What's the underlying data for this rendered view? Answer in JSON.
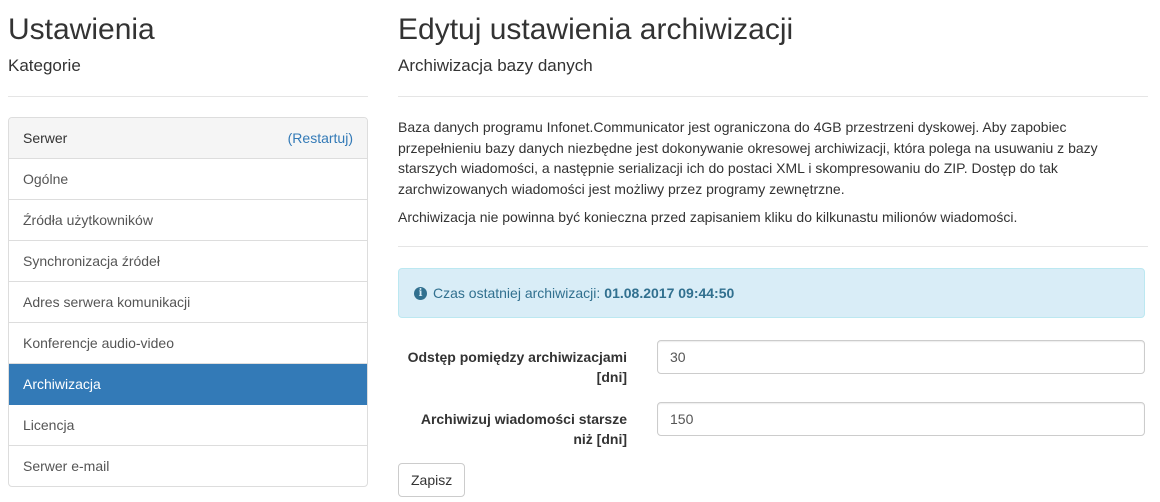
{
  "sidebar": {
    "title": "Ustawienia",
    "subtitle": "Kategorie",
    "header_label": "Serwer",
    "restart_label": "(Restartuj)",
    "items": [
      {
        "label": "Ogólne"
      },
      {
        "label": "Źródła użytkowników"
      },
      {
        "label": "Synchronizacja źródeł"
      },
      {
        "label": "Adres serwera komunikacji"
      },
      {
        "label": "Konferencje audio-video"
      },
      {
        "label": "Archiwizacja"
      },
      {
        "label": "Licencja"
      },
      {
        "label": "Serwer e-mail"
      }
    ],
    "active_item": "Archiwizacja"
  },
  "main": {
    "title": "Edytuj ustawienia archiwizacji",
    "subtitle": "Archiwizacja bazy danych",
    "description": "Baza danych programu Infonet.Communicator jest ograniczona do 4GB przestrzeni dyskowej. Aby zapobiec przepełnieniu bazy danych niezbędne jest dokonywanie okresowej archiwizacji, która polega na usuwaniu z bazy starszych wiadomości, a następnie serializacji ich do postaci XML i skompresowaniu do ZIP. Dostęp do tak zarchwizowanych wiadomości jest możliwy przez programy zewnętrzne.",
    "note": "Archiwizacja nie powinna być konieczna przed zapisaniem kliku do kilkunastu milionów wiadomości.",
    "alert": {
      "label": "Czas ostatniej archiwizacji:",
      "value": "01.08.2017 09:44:50"
    },
    "form": {
      "interval_label": "Odstęp pomiędzy archiwizacjami [dni]",
      "interval_value": "30",
      "older_than_label": "Archiwizuj wiadomości starsze niż [dni]",
      "older_than_value": "150",
      "save_label": "Zapisz"
    }
  },
  "colors": {
    "accent": "#337ab7",
    "alert_bg": "#d9edf7",
    "alert_text": "#31708f"
  }
}
